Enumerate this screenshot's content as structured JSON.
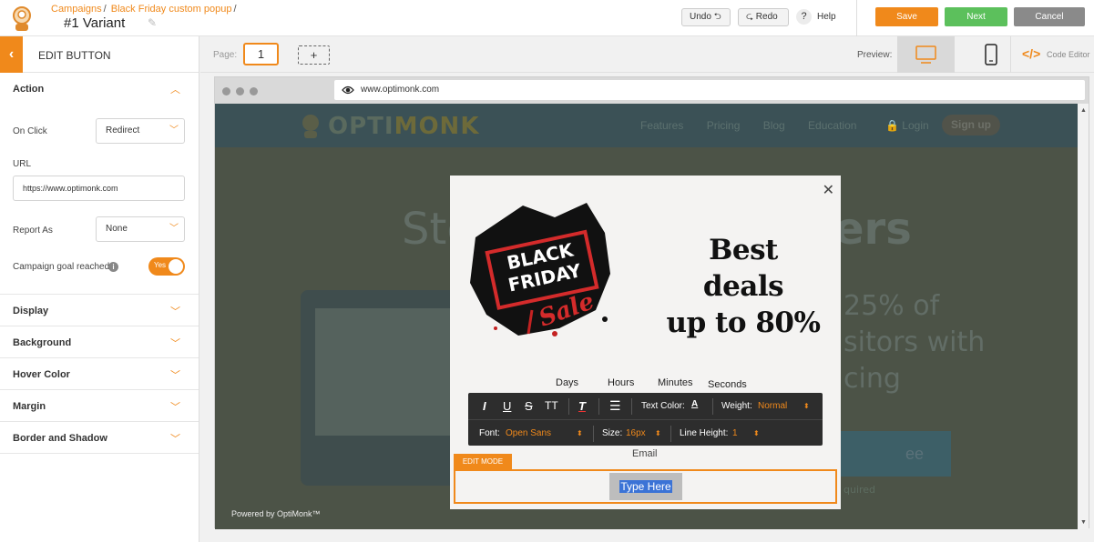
{
  "header": {
    "breadcrumb_campaigns": "Campaigns",
    "breadcrumb_campaign": "Black Friday custom popup",
    "variant_title": "#1 Variant",
    "undo_label": "Undo",
    "redo_label": "Redo",
    "help_label": "Help",
    "save_label": "Save",
    "next_label": "Next",
    "cancel_label": "Cancel",
    "colors": {
      "accent": "#f0891b",
      "next": "#5cc05c",
      "cancel": "#8a8a8a"
    }
  },
  "panel": {
    "title": "EDIT BUTTON",
    "action_section": "Action",
    "on_click_label": "On Click",
    "on_click_value": "Redirect",
    "url_label": "URL",
    "url_value": "https://www.optimonk.com",
    "report_as_label": "Report As",
    "report_as_value": "None",
    "goal_label": "Campaign goal reached",
    "goal_toggle_label": "Yes",
    "sections": [
      "Display",
      "Background",
      "Hover Color",
      "Margin",
      "Border and Shadow"
    ]
  },
  "editor": {
    "page_label": "Page:",
    "page_number": "1",
    "add_page": "+",
    "preview_label": "Preview:",
    "code_editor_label": "Code Editor"
  },
  "browser": {
    "url": "www.optimonk.com",
    "site_logo_a": "OPTI",
    "site_logo_b": "MONK",
    "site_links": "Features Pricing Blog Education",
    "site_login": "Login",
    "site_signup": "Sign up",
    "powered_by": "Powered by OptiMonk™"
  },
  "popup": {
    "headline_line1": "Best deals",
    "headline_line2": "up to 80%",
    "timer_labels": [
      "Days",
      "Hours",
      "Minutes",
      "Seconds"
    ],
    "toolbar": {
      "italic": "I",
      "underline": "U",
      "strike": "S",
      "caps": "TT",
      "clear": "T",
      "text_color_label": "Text Color:",
      "weight_label": "Weight:",
      "weight_value": "Normal",
      "font_label": "Font:",
      "font_value": "Open Sans",
      "size_label": "Size:",
      "size_value": "16px",
      "line_height_label": "Line Height:",
      "line_height_value": "1"
    },
    "email_label": "Email",
    "edit_mode_label": "EDIT MODE",
    "button_text": "Type Here"
  }
}
